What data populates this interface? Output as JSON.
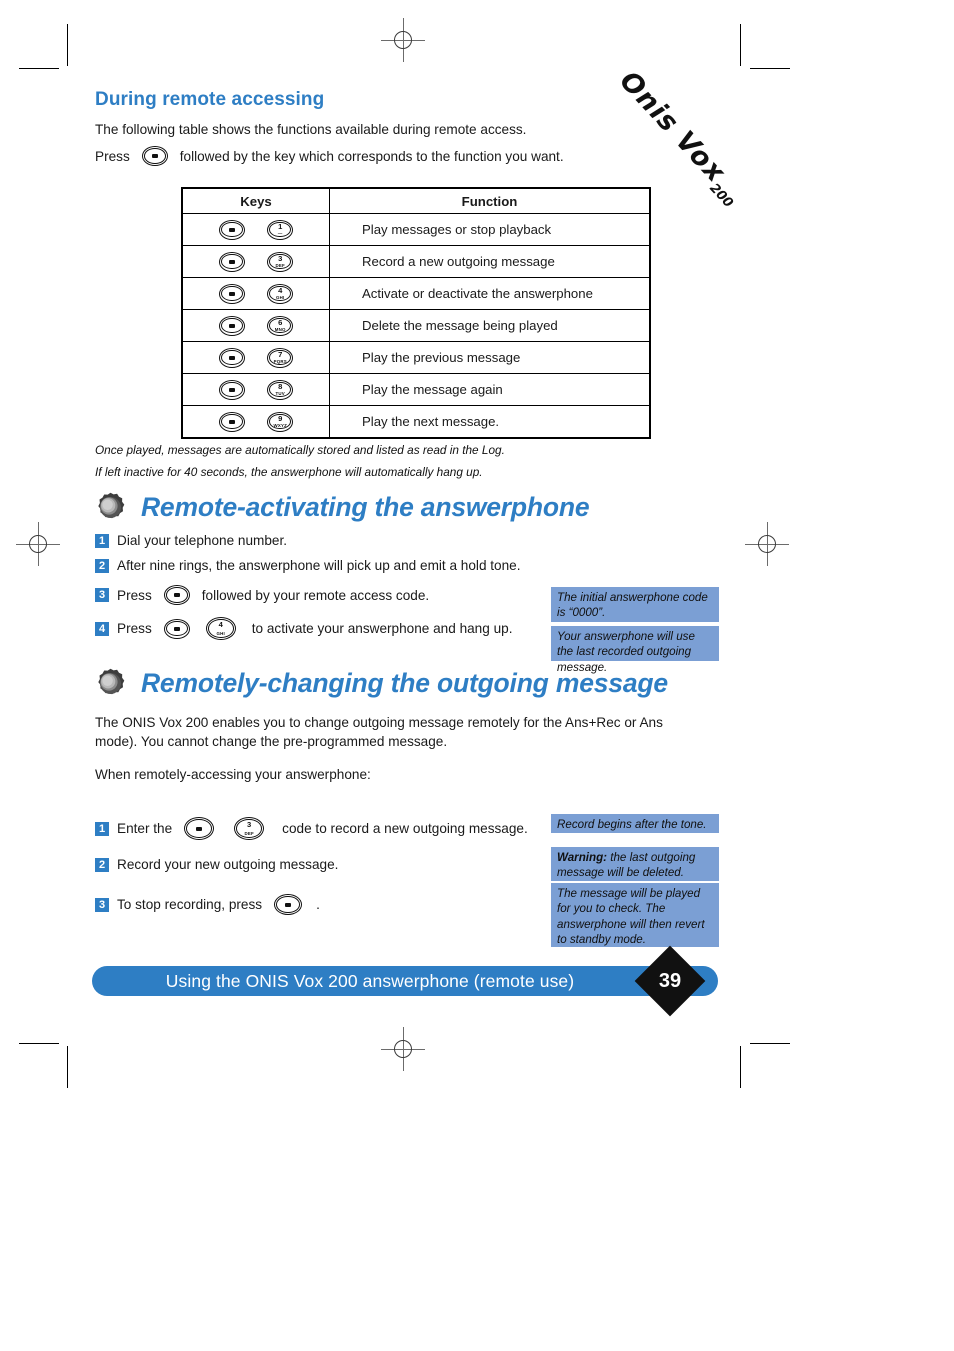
{
  "logo": {
    "brand": "Onis Vox",
    "model": "200"
  },
  "section1": {
    "heading": "During remote accessing",
    "intro": "The following table shows the functions available during remote access.",
    "press_prefix": "Press",
    "press_suffix": "followed by the key which corresponds to the function you want.",
    "table": {
      "headers": [
        "Keys",
        "Function"
      ],
      "rows": [
        {
          "keys": [
            {
              "type": "star"
            },
            {
              "type": "num",
              "digit": "1",
              "letters": "—"
            }
          ],
          "function": "Play messages or stop playback"
        },
        {
          "keys": [
            {
              "type": "star"
            },
            {
              "type": "num",
              "digit": "3",
              "letters": "DEF"
            }
          ],
          "function": "Record a new outgoing message"
        },
        {
          "keys": [
            {
              "type": "star"
            },
            {
              "type": "num",
              "digit": "4",
              "letters": "GHI"
            }
          ],
          "function": "Activate or deactivate the answerphone"
        },
        {
          "keys": [
            {
              "type": "star"
            },
            {
              "type": "num",
              "digit": "6",
              "letters": "MNO"
            }
          ],
          "function": "Delete the message being played"
        },
        {
          "keys": [
            {
              "type": "star"
            },
            {
              "type": "num",
              "digit": "7",
              "letters": "PQRS"
            }
          ],
          "function": "Play the previous message"
        },
        {
          "keys": [
            {
              "type": "star"
            },
            {
              "type": "num",
              "digit": "8",
              "letters": "TUV"
            }
          ],
          "function": "Play the message again"
        },
        {
          "keys": [
            {
              "type": "star"
            },
            {
              "type": "num",
              "digit": "9",
              "letters": "WXYZ"
            }
          ],
          "function": "Play the next message."
        }
      ]
    },
    "footnote1": "Once played, messages are automatically stored and listed as read in the Log.",
    "footnote2": "If left inactive for 40 seconds, the answerphone will automatically hang up."
  },
  "section2": {
    "heading": "Remote-activating the answerphone",
    "steps": {
      "s1_num": "1",
      "s1_text": "Dial your telephone number.",
      "s2_num": "2",
      "s2_text": "After nine rings, the answerphone will pick up and emit a hold tone.",
      "s3_num": "3",
      "s3_pre": "Press",
      "s3_post": "followed by your remote access code.",
      "s4_num": "4",
      "s4_pre": "Press",
      "s4_post": "to activate your answerphone and hang up."
    },
    "notes": [
      "The initial answerphone code is “0000”.",
      "Your answerphone will use the last recorded outgoing message."
    ]
  },
  "section3": {
    "heading": "Remotely-changing the outgoing message",
    "para1": "The ONIS Vox 200 enables you to change outgoing message remotely for the Ans+Rec or Ans mode). You cannot change the pre-programmed message.",
    "para2": "When remotely-accessing your answerphone:",
    "steps": {
      "s1_num": "1",
      "s1_pre": "Enter the",
      "s1_post": "code to record a new outgoing message.",
      "s2_num": "2",
      "s2_text": "Record your new outgoing message.",
      "s3_num": "3",
      "s3_pre": "To stop recording, press",
      "s3_post": "."
    },
    "notes": {
      "n1": "Record begins after the tone.",
      "n2_bold": "Warning:",
      "n2_rest": " the last outgoing message will be deleted.",
      "n3": "The message will be played for you to check. The answerphone will then revert to standby mode."
    }
  },
  "footer": {
    "title": "Using the ONIS Vox 200 answerphone (remote use)",
    "page": "39"
  },
  "colors": {
    "accent_blue": "#2e7ec4",
    "note_blue": "#7b9fd4",
    "badge_black": "#111111"
  }
}
